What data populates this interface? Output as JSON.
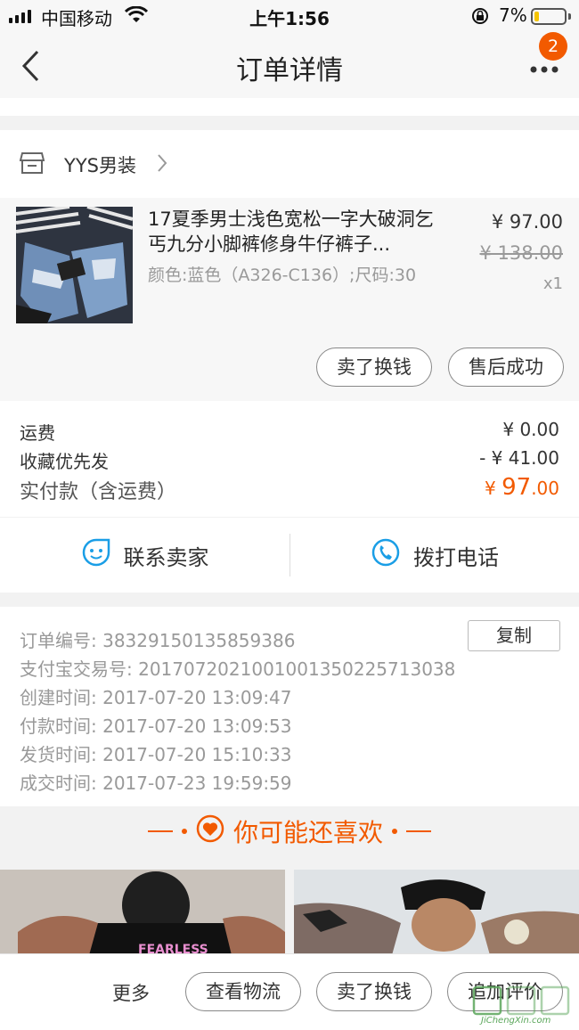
{
  "status_bar": {
    "carrier": "中国移动",
    "time": "上午1:56",
    "battery": "7%"
  },
  "nav": {
    "title": "订单详情",
    "badge_count": "2"
  },
  "shop": {
    "name": "YYS男装"
  },
  "product": {
    "title": "17夏季男士浅色宽松一字大破洞乞丐九分小脚裤修身牛仔裤子...",
    "spec": "颜色:蓝色（A326-C136）;尺码:30",
    "price": "¥ 97.00",
    "original_price": "¥ 138.00",
    "quantity": "x1",
    "buttons": {
      "resell": "卖了换钱",
      "after_sale": "售后成功"
    }
  },
  "fees": {
    "shipping_label": "运费",
    "shipping_value": "¥ 0.00",
    "discount_label": "收藏优先发",
    "discount_value": "- ¥ 41.00",
    "paid_label": "实付款（含运费）",
    "paid_currency": "¥",
    "paid_integer": "97",
    "paid_decimal": ".00"
  },
  "contact": {
    "seller": "联系卖家",
    "phone": "拨打电话"
  },
  "order_info": {
    "copy_button": "复制",
    "lines": [
      "订单编号:   38329150135859386",
      "支付宝交易号:   2017072021001001350225713038",
      "创建时间:   2017-07-20 13:09:47",
      "付款时间:   2017-07-20 13:09:53",
      "发货时间:   2017-07-20 15:10:33",
      "成交时间:   2017-07-23 19:59:59"
    ]
  },
  "recommend": {
    "title": "你可能还喜欢"
  },
  "bottom_bar": {
    "more": "更多",
    "logistics": "查看物流",
    "resell": "卖了换钱",
    "review": "追加评价"
  },
  "watermark": {
    "text": "JiChengXin.com"
  },
  "colors": {
    "accent": "#f25a00",
    "contact_icon": "#1a9ee6",
    "background": "#f2f2f2"
  }
}
